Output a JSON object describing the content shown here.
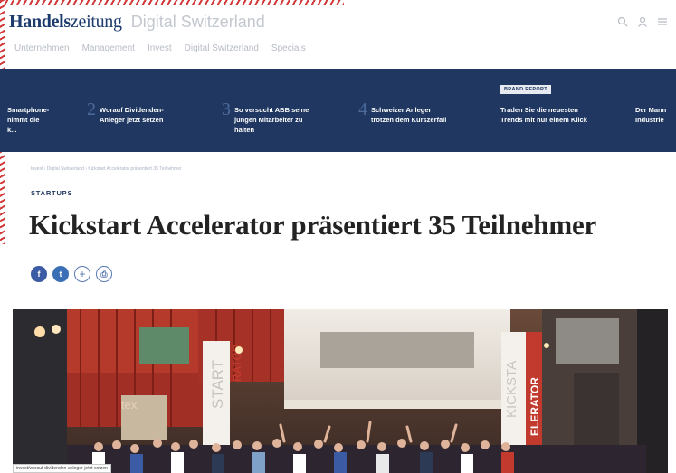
{
  "colors": {
    "brand_navy": "#1f3761",
    "frame_red": "#d23a3a",
    "share_blue": "#3b5ba5"
  },
  "header": {
    "logo_bold": "Handels",
    "logo_rest": "zeitung",
    "channel": "Digital Switzerland",
    "icons": [
      "search-icon",
      "user-icon",
      "menu-icon"
    ]
  },
  "nav": {
    "items": [
      "Unternehmen",
      "Management",
      "Invest",
      "Digital Switzerland",
      "Specials"
    ]
  },
  "teaser": {
    "items": [
      {
        "num": "",
        "text": "Smartphone-\nnimmt die\nk..."
      },
      {
        "num": "2",
        "text": "Worauf Dividenden-\nAnleger jetzt setzen"
      },
      {
        "num": "3",
        "text": "So versucht ABB seine\njungen Mitarbeiter zu\nhalten"
      },
      {
        "num": "4",
        "text": "Schweizer Anleger\ntrotzen dem Kurszerfall"
      }
    ],
    "brand_report": {
      "badge": "BRAND REPORT",
      "text": "Traden Sie die neuesten\nTrends mit nur einem Klick"
    },
    "partial": "Der Mann\nIndustrie"
  },
  "article": {
    "breadcrumb": "Invest › Digital Switzerland › Kickstart Accelerator präsentiert 35 Teilnehmer",
    "kicker": "STARTUPS",
    "headline": "Kickstart Accelerator präsentiert 35 Teilnehmer"
  },
  "share": {
    "facebook": "f",
    "twitter": "t",
    "more": "+",
    "print": "⎙"
  },
  "hero": {
    "signage": [
      "START",
      "RATOR",
      "KICKSTA",
      "ELERATOR",
      "tex"
    ]
  },
  "status_bar": {
    "url": "invest/worauf-dividenden-anleger-jetzt-setzen"
  }
}
